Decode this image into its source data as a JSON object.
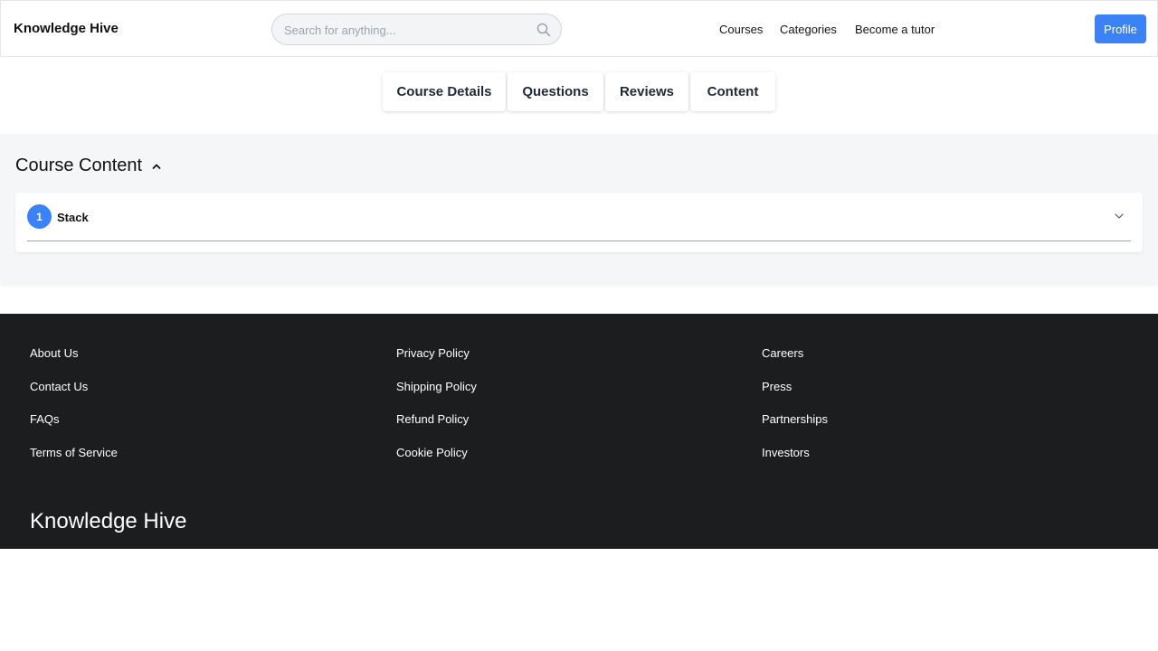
{
  "header": {
    "brand": "Knowledge Hive",
    "search_placeholder": "Search for anything...",
    "nav": [
      "Courses",
      "Categories",
      "Become a tutor"
    ],
    "profile_label": "Profile",
    "accent_color": "#3b82f6"
  },
  "tabs": [
    "Course Details",
    "Questions",
    "Reviews",
    "Content"
  ],
  "content": {
    "title": "Course Content",
    "sections": [
      {
        "number": "1",
        "title": "Stack"
      }
    ]
  },
  "footer": {
    "columns": [
      [
        "About Us",
        "Contact Us",
        "FAQs",
        "Terms of Service"
      ],
      [
        "Privacy Policy",
        "Shipping Policy",
        "Refund Policy",
        "Cookie Policy"
      ],
      [
        "Careers",
        "Press",
        "Partnerships",
        "Investors"
      ]
    ],
    "brand": "Knowledge Hive",
    "background_color": "#1c1d1f"
  },
  "icons": {
    "search": "search-icon",
    "collapse": "chevron-up-icon",
    "expand": "chevron-down-icon"
  }
}
